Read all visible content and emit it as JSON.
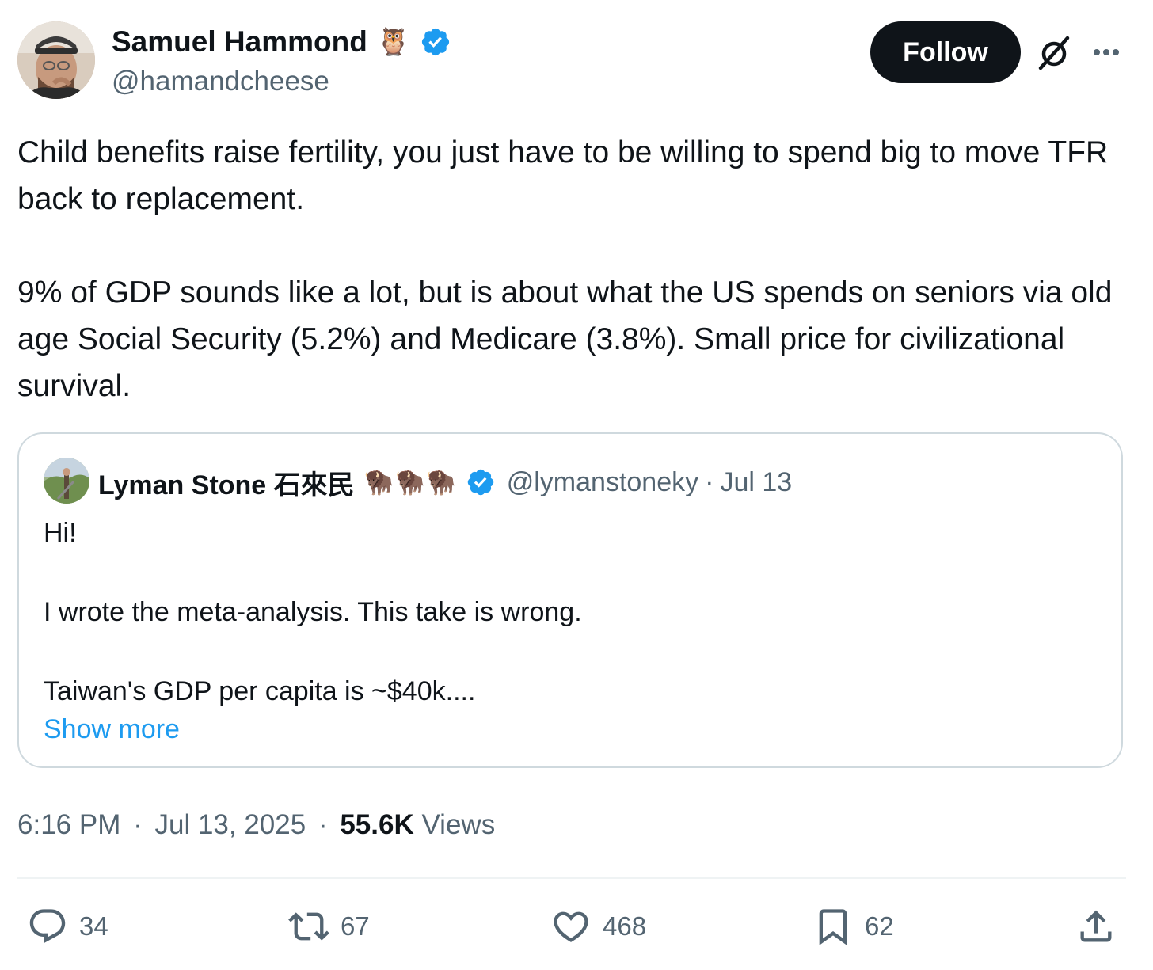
{
  "author": {
    "display_name": "Samuel Hammond",
    "name_emoji": "🦉",
    "handle": "@hamandcheese",
    "verified": true
  },
  "header": {
    "follow_label": "Follow"
  },
  "tweet": {
    "text": "Child benefits raise fertility, you just have to be willing to spend big to move TFR back to replacement.\n\n9% of GDP sounds like a lot, but is about what the US spends on seniors via old age Social Security (5.2%) and Medicare (3.8%). Small price for civilizational survival."
  },
  "quote": {
    "display_name": "Lyman Stone 石來民",
    "name_emoji": "🦬🦬🦬",
    "handle": "@lymanstoneky",
    "separator": "·",
    "date": "Jul 13",
    "text": "Hi!\n\nI wrote the meta-analysis. This take is wrong.\n\nTaiwan's GDP per capita is ~$40k....",
    "show_more": "Show more"
  },
  "meta": {
    "time": "6:16 PM",
    "date": "Jul 13, 2025",
    "separator": "·",
    "views_count": "55.6K",
    "views_label": "Views"
  },
  "actions": {
    "replies": "34",
    "reposts": "67",
    "likes": "468",
    "bookmarks": "62"
  },
  "colors": {
    "verified": "#1d9bf0",
    "link": "#1d9bf0",
    "secondary_text": "#536471",
    "follow_bg": "#0f1419"
  },
  "icons": [
    "verified-badge-icon",
    "grok-icon",
    "more-icon",
    "reply-icon",
    "repost-icon",
    "like-icon",
    "bookmark-icon",
    "share-icon"
  ]
}
